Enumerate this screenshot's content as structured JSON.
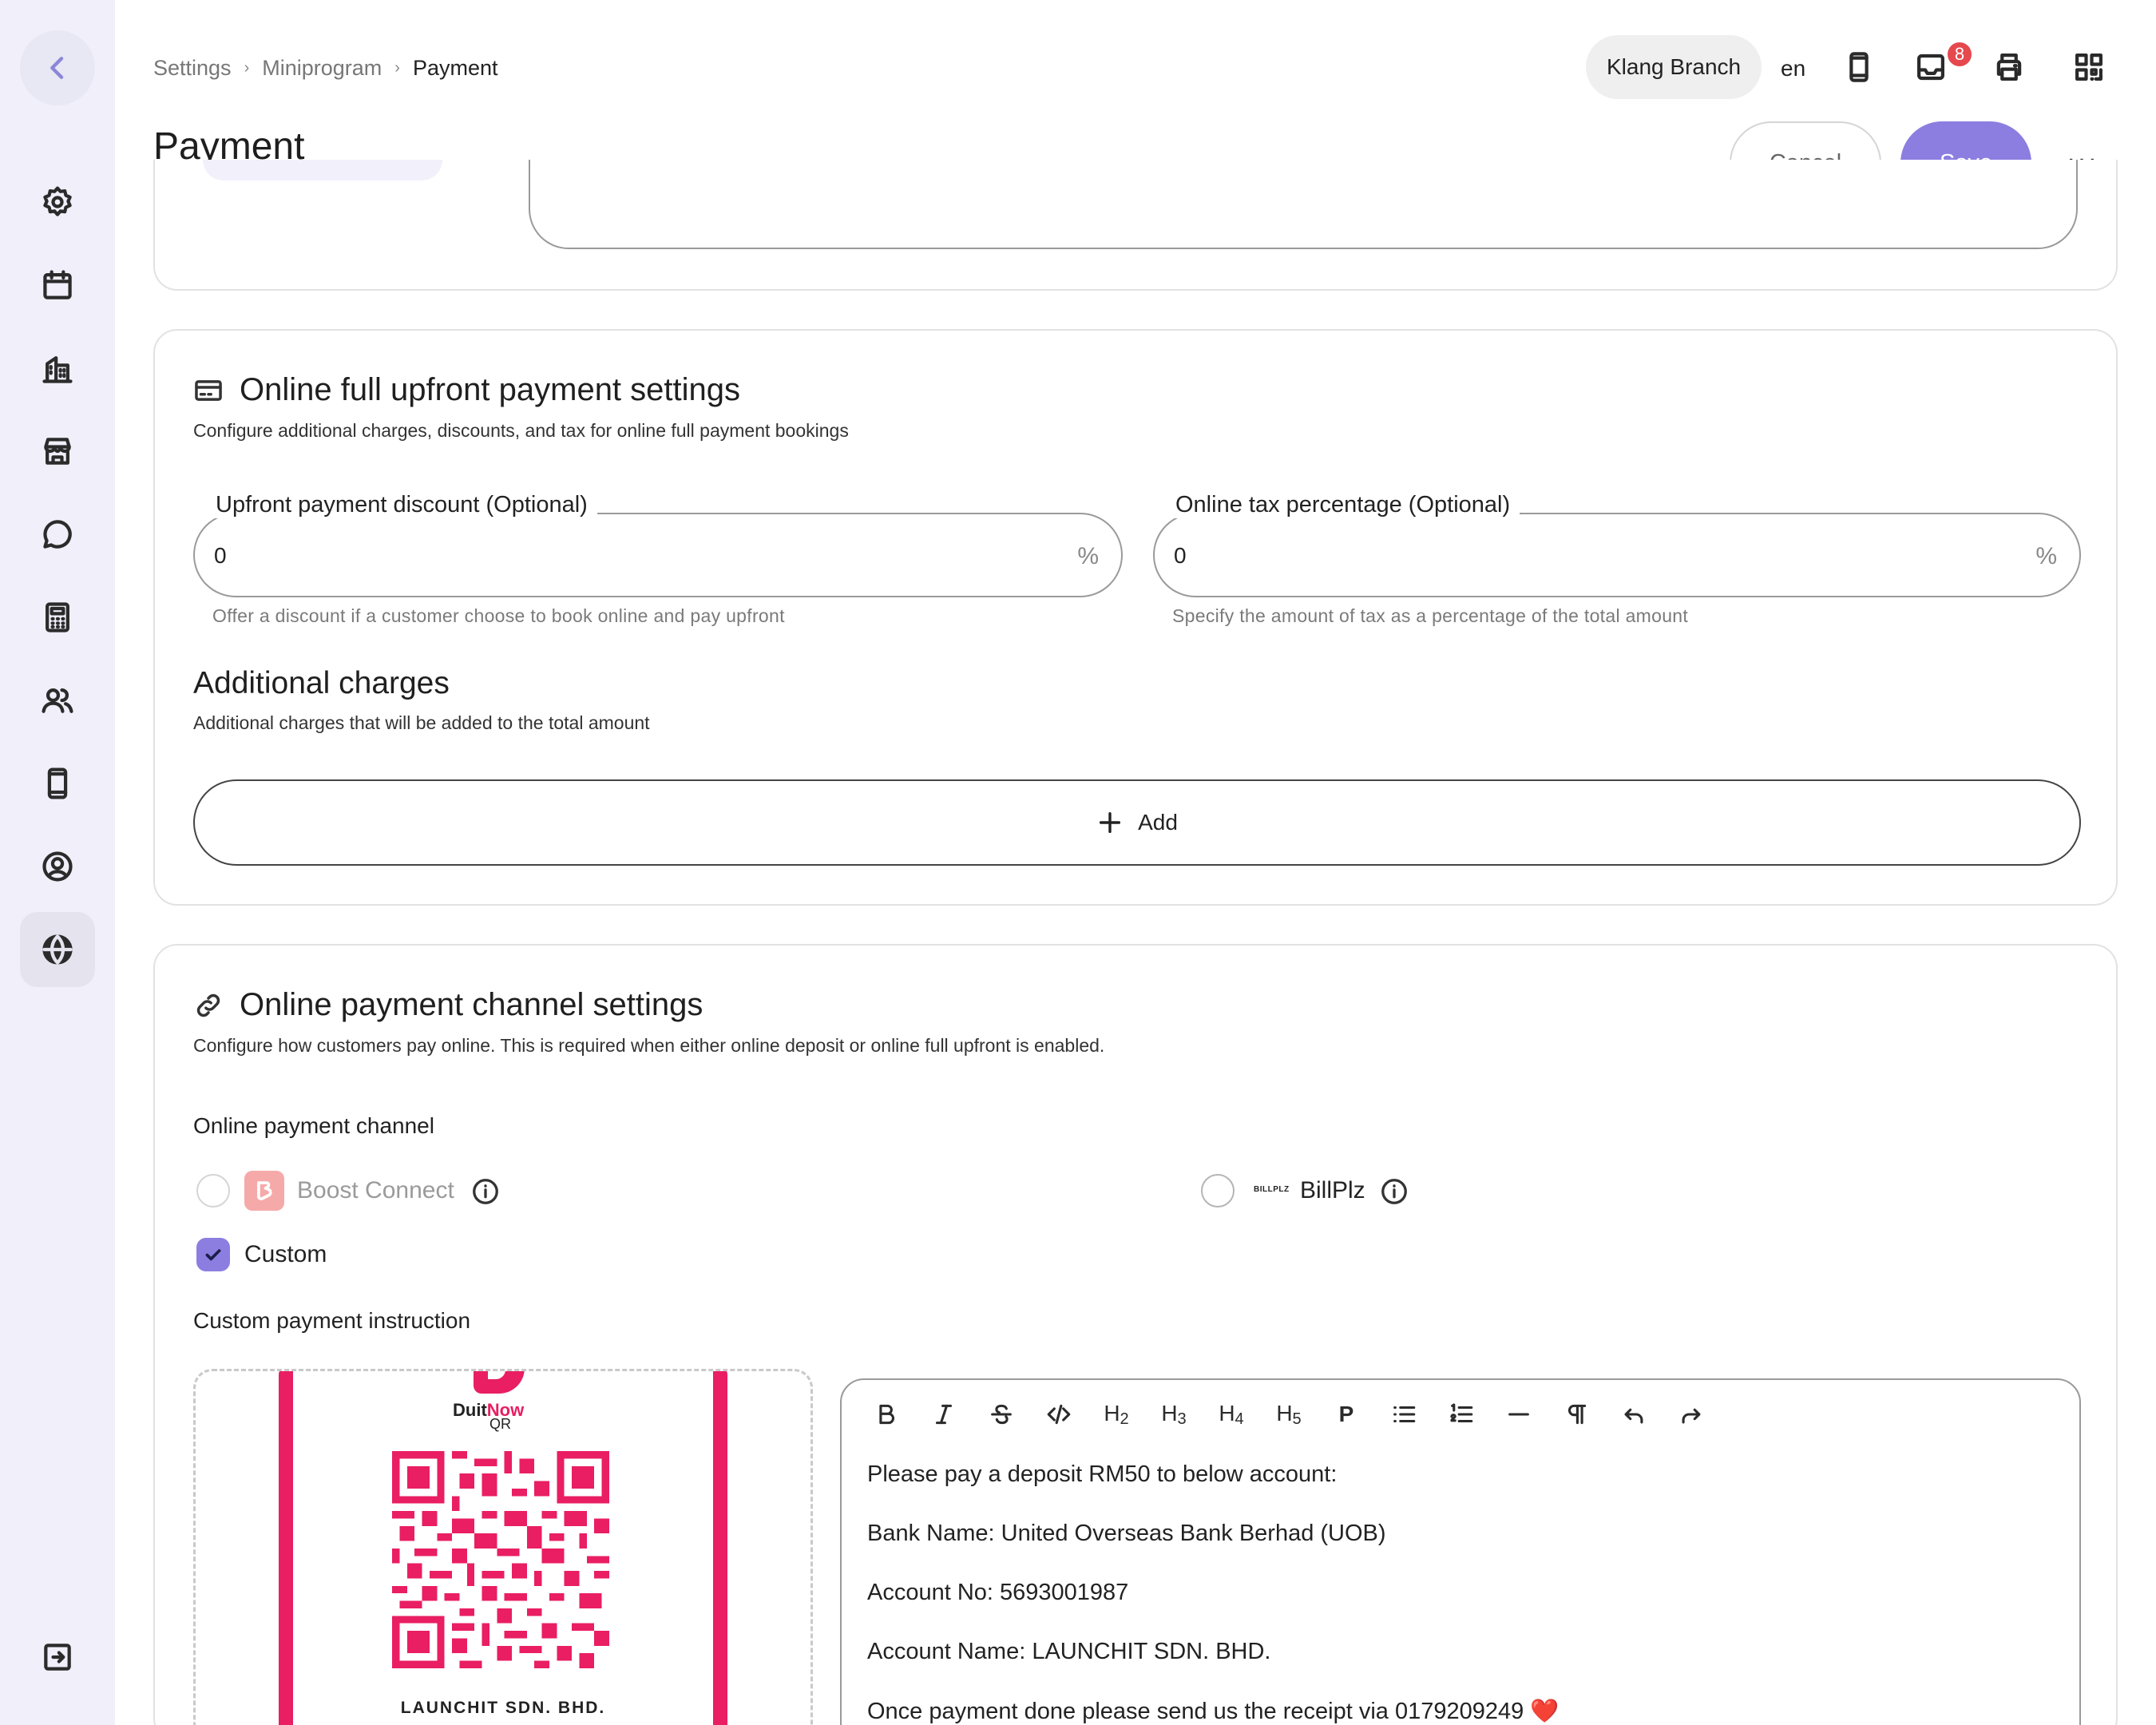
{
  "breadcrumb": {
    "items": [
      "Settings",
      "Miniprogram",
      "Payment"
    ],
    "sep": "›"
  },
  "page": {
    "title": "Payment"
  },
  "header": {
    "branch": "Klang Branch",
    "language": "en",
    "notification_count": "8",
    "cancel_label": "Cancel",
    "save_label": "Save",
    "more_label": "···"
  },
  "sidebar": {
    "items": [
      "settings-icon",
      "calendar-icon",
      "building-icon",
      "store-icon",
      "chat-icon",
      "calculator-icon",
      "users-icon",
      "mobile-icon",
      "user-circle-icon",
      "globe-icon"
    ],
    "active": "globe-icon"
  },
  "upfront": {
    "title": "Online full upfront payment settings",
    "description": "Configure additional charges, discounts, and tax for online full payment bookings",
    "discount": {
      "label": "Upfront payment discount (Optional)",
      "value": "0",
      "unit": "%",
      "helper": "Offer a discount if a customer choose to book online and pay upfront"
    },
    "tax": {
      "label": "Online tax percentage (Optional)",
      "value": "0",
      "unit": "%",
      "helper": "Specify the amount of tax as a percentage of the total amount"
    },
    "charges_title": "Additional charges",
    "charges_description": "Additional charges that will be added to the total amount",
    "add_label": "Add"
  },
  "channel": {
    "title": "Online payment channel settings",
    "description": "Configure how customers pay online. This is required when either online deposit or online full upfront is enabled.",
    "channel_label": "Online payment channel",
    "options": [
      {
        "label": "Boost Connect",
        "checked": false,
        "disabled": true
      },
      {
        "label": "BillPlz",
        "checked": false,
        "logo_text": "BILLPLZ"
      },
      {
        "label": "Custom",
        "checked": true
      }
    ],
    "instruction_label": "Custom payment instruction",
    "qr": {
      "brand": "Duit",
      "brand_accent": "Now",
      "sub": "QR",
      "company": "LAUNCHIT SDN. BHD."
    },
    "editor_lines": [
      "Please pay a deposit RM50 to below account:",
      "Bank Name: United Overseas Bank Berhad (UOB)",
      "Account No: 5693001987",
      "Account Name: LAUNCHIT SDN. BHD.",
      "Once payment done please send us the receipt via 0179209249 ❤️"
    ]
  },
  "colors": {
    "accent": "#8b7ee0",
    "sidebar_bg": "#f0effa",
    "badge": "#e5484d",
    "duitnow": "#e91e63"
  }
}
